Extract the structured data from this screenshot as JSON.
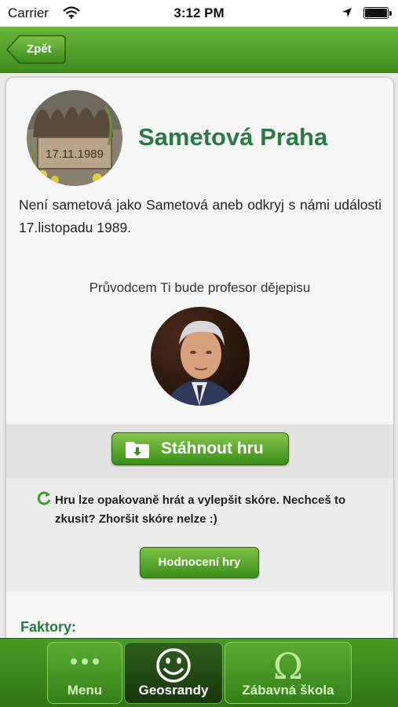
{
  "status_bar": {
    "carrier": "Carrier",
    "time": "3:12 PM",
    "icons": [
      "wifi-icon",
      "location-arrow-icon",
      "battery-icon"
    ]
  },
  "navbar": {
    "back_label": "Zpět"
  },
  "game": {
    "title": "Sametová Praha",
    "image_text": "17.11.1989",
    "description": "Není sametová jako Sametová aneb odkryj s námi události 17.listopadu 1989.",
    "guide_label": "Průvodcem Ti bude profesor dějepisu",
    "download_label": "Stáhnout hru",
    "replay_text": "Hru lze opakovaně hrát a vylepšit skóre. Nechceš to zkusit? Zhoršit skóre nelze :)",
    "rate_label": "Hodnocení hry",
    "factors_heading": "Faktory:"
  },
  "tabbar": {
    "tabs": [
      {
        "label": "Menu",
        "icon": "dots-icon",
        "active": false
      },
      {
        "label": "Geosrandy",
        "icon": "smiley-icon",
        "active": true
      },
      {
        "label": "Zábavná škola",
        "icon": "omega-icon",
        "active": false
      }
    ]
  },
  "colors": {
    "brand_green": "#3f8b1f",
    "title_green": "#2a7a44",
    "active_tab": "#1f4412"
  }
}
